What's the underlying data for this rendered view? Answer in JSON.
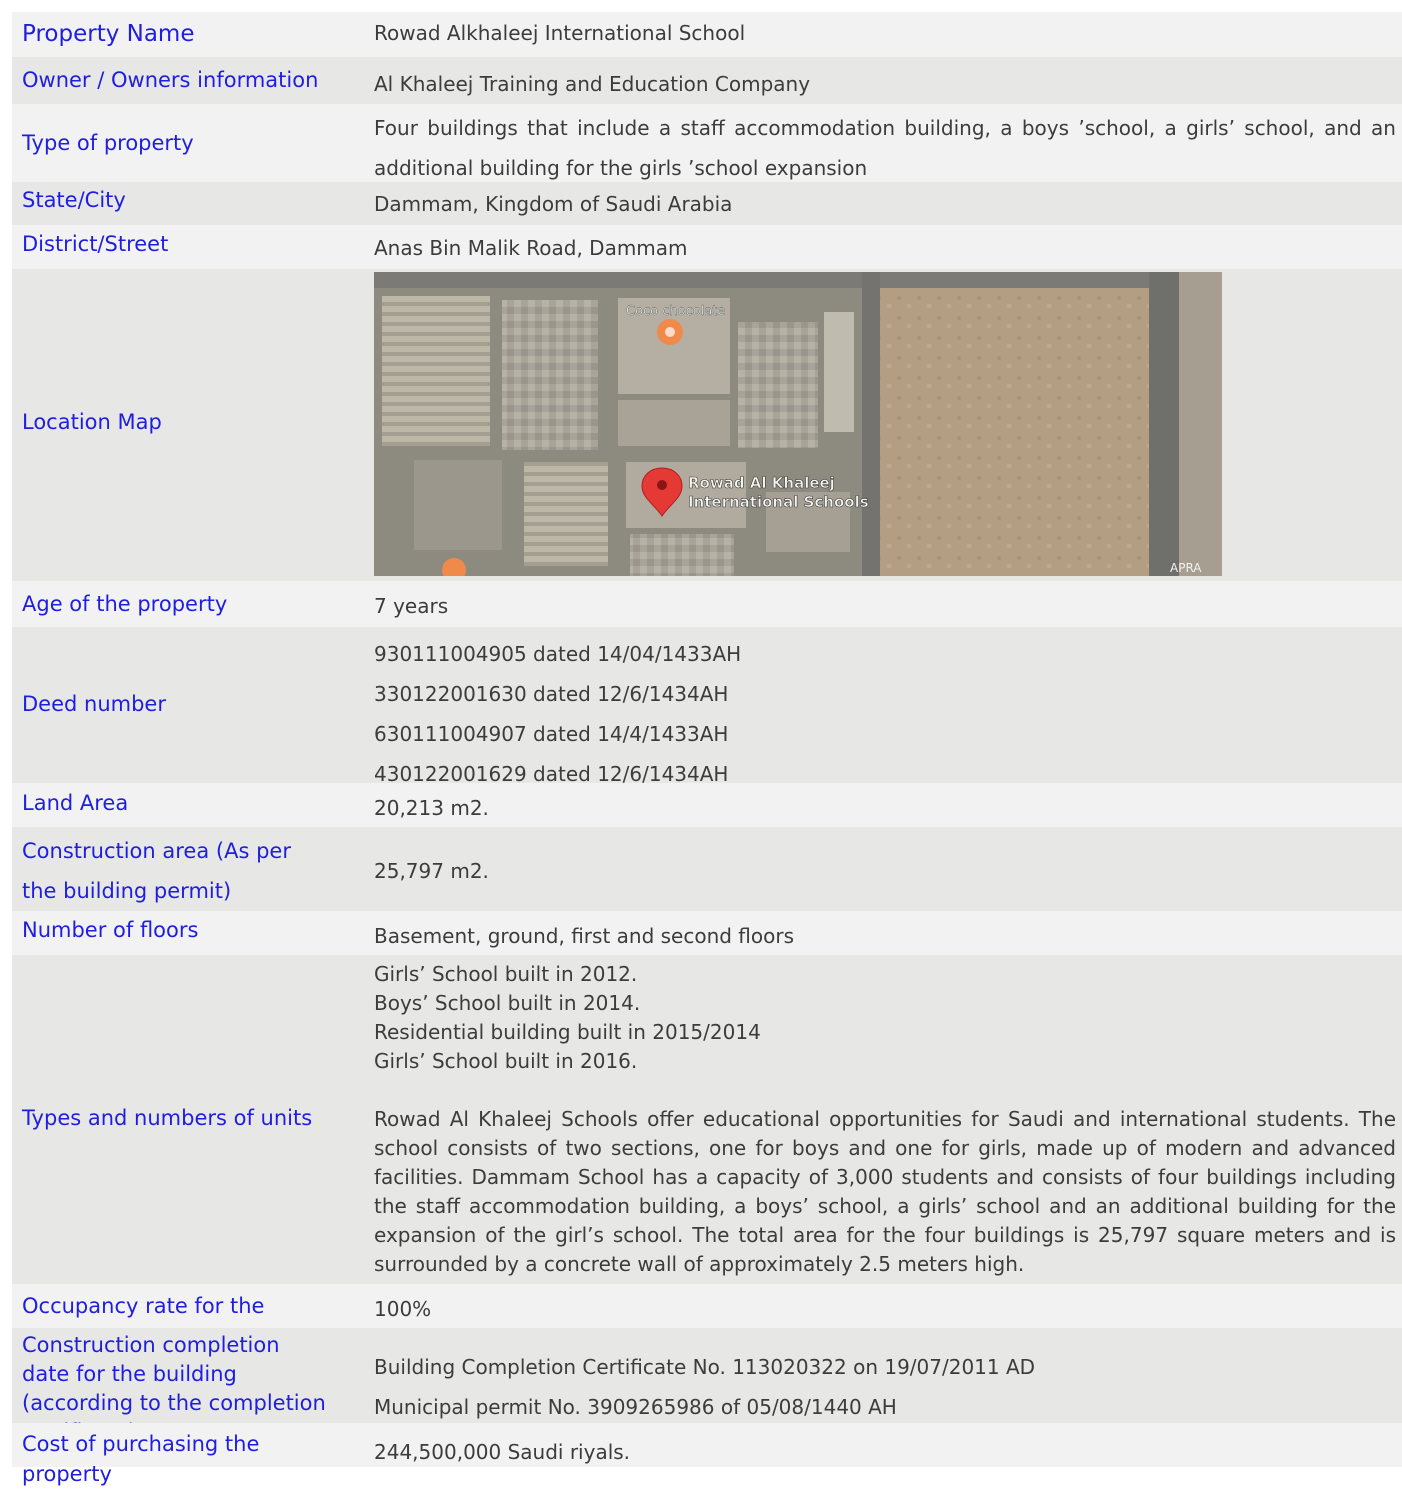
{
  "rows": [
    {
      "label": "Property Name",
      "value": "Rowad Alkhaleej International School"
    },
    {
      "label": "Owner / Owners information",
      "value": "Al Khaleej Training and Education Company"
    },
    {
      "label": "Type of property",
      "value": "Four buildings that include a staff accommodation building, a boys ’school, a girls’ school, and an additional building for the girls ’school expansion"
    },
    {
      "label": "State/City",
      "value": "Dammam, Kingdom of Saudi Arabia"
    },
    {
      "label": "District/Street",
      "value": "Anas Bin Malik Road, Dammam"
    },
    {
      "label": "Location Map"
    },
    {
      "label": "Age of the property",
      "value": "7 years"
    },
    {
      "label": "Deed number",
      "values": [
        "930111004905 dated 14/04/1433AH",
        "330122001630 dated 12/6/1434AH",
        "630111004907 dated 14/4/1433AH",
        "430122001629 dated 12/6/1434AH"
      ]
    },
    {
      "label": "Land Area",
      "value": "20,213 m2."
    },
    {
      "label": "Construction area (As per  the building permit)",
      "value": "25,797 m2."
    },
    {
      "label": "Number of floors",
      "value": "Basement, ground, first and second floors"
    },
    {
      "label": "Types and numbers of units",
      "values": [
        "Girls’ School built in 2012.",
        "Boys’ School built in 2014.",
        "Residential building built in 2015/2014",
        "Girls’ School built in 2016."
      ],
      "paragraph": "Rowad Al Khaleej Schools offer educational opportunities for Saudi and international students. The school consists of two sections, one for boys and one for girls, made up of modern and advanced facilities. Dammam School has a capacity of 3,000 students and consists of four buildings including the staff accommodation building, a boys’ school, a girls’ school and an additional building for the expansion of the girl’s school. The total area for the four buildings is 25,797 square meters and is surrounded by a concrete wall of approximately 2.5 meters high."
    },
    {
      "label": "Occupancy rate for the property",
      "value": "100%"
    },
    {
      "label": "Construction completion date for the building (according to the completion certificate)",
      "values": [
        "Building Completion Certificate No. 113020322 on 19/07/2011 AD",
        "Municipal permit No. 3909265986 of 05/08/1440 AH"
      ]
    },
    {
      "label": "Cost of purchasing the property",
      "value": "244,500,000 Saudi riyals."
    }
  ],
  "map": {
    "marker_label_line1": "Rowad Al Khaleej",
    "marker_label_line2": "International Schools",
    "poi_label": "Coco chocolate",
    "corner_label": "APRA",
    "marker_icon": "map-pin-icon",
    "poi_icon": "place-marker-icon",
    "colors": {
      "pin": "#e53935",
      "poi": "#f08a4b",
      "ground": "#8d8a80",
      "sand": "#b39e84"
    }
  }
}
